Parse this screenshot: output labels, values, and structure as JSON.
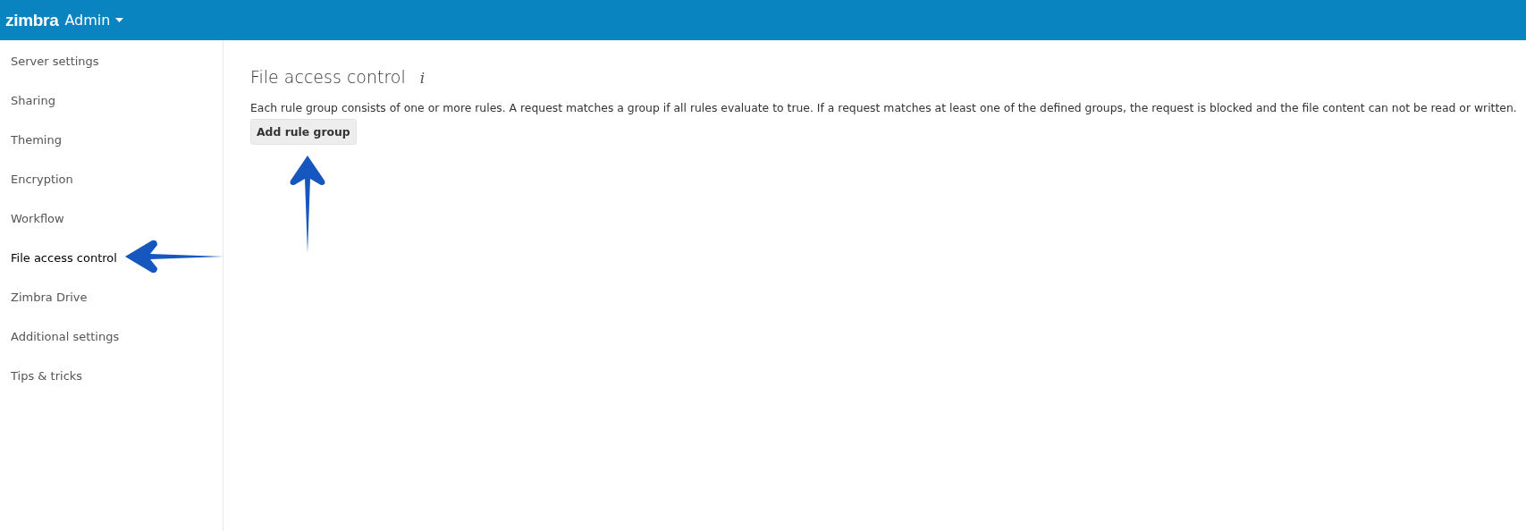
{
  "header": {
    "logo": "zimbra",
    "title": "Admin"
  },
  "sidebar": {
    "items": [
      {
        "label": "Server settings",
        "selected": false
      },
      {
        "label": "Sharing",
        "selected": false
      },
      {
        "label": "Theming",
        "selected": false
      },
      {
        "label": "Encryption",
        "selected": false
      },
      {
        "label": "Workflow",
        "selected": false
      },
      {
        "label": "File access control",
        "selected": true
      },
      {
        "label": "Zimbra Drive",
        "selected": false
      },
      {
        "label": "Additional settings",
        "selected": false
      },
      {
        "label": "Tips & tricks",
        "selected": false
      }
    ]
  },
  "content": {
    "title": "File access control",
    "info_icon": "i",
    "description": "Each rule group consists of one or more rules. A request matches a group if all rules evaluate to true. If a request matches at least one of the defined groups, the request is blocked and the file content can not be read or written.",
    "button": "Add rule group"
  }
}
